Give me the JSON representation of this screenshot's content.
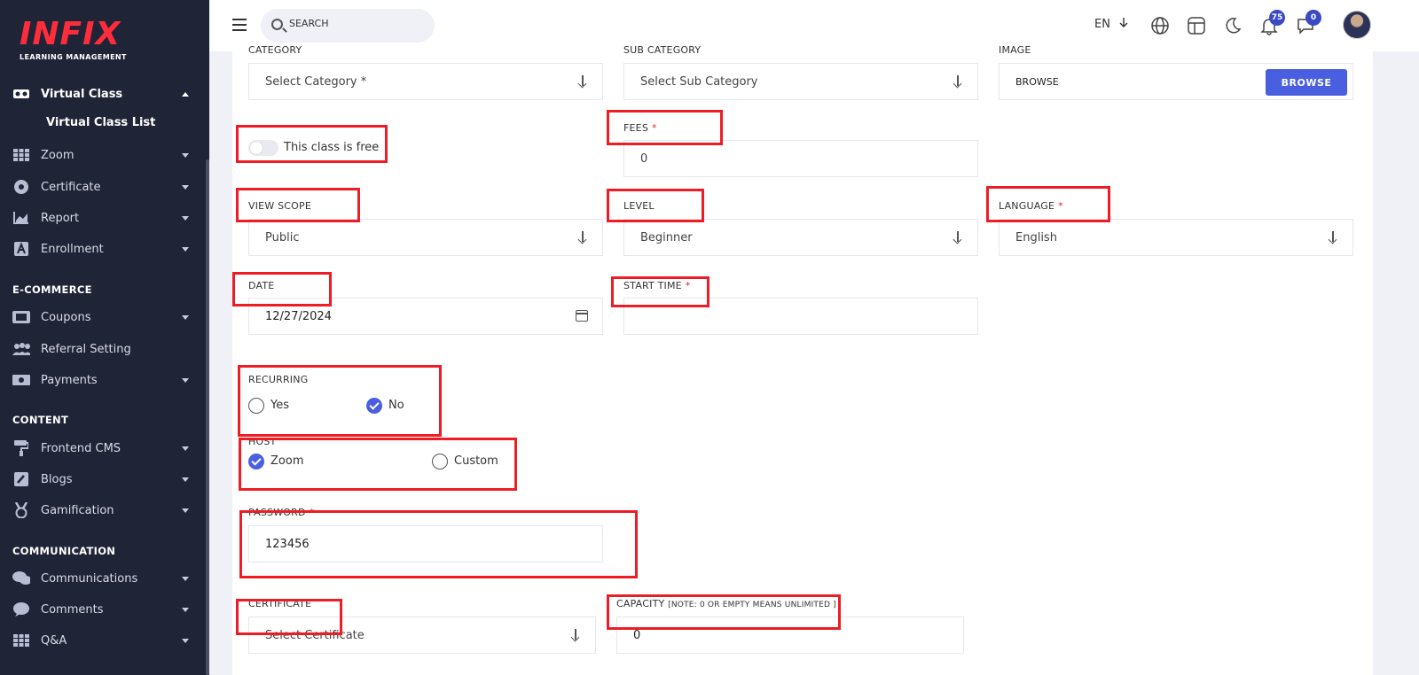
{
  "brand": {
    "logo_text": "INFIX",
    "logo_subtitle": "LEARNING MANAGEMENT"
  },
  "sidebar": {
    "active_group": {
      "label": "Virtual Class",
      "icon": "vr-headset-icon"
    },
    "active_sub": "Virtual Class List",
    "items": [
      {
        "label": "Zoom",
        "icon": "grid-icon"
      },
      {
        "label": "Certificate",
        "icon": "gear-badge-icon"
      },
      {
        "label": "Report",
        "icon": "chart-icon"
      },
      {
        "label": "Enrollment",
        "icon": "enroll-icon"
      }
    ],
    "sections": [
      {
        "title": "E-COMMERCE",
        "items": [
          {
            "label": "Coupons",
            "icon": "ticket-icon"
          },
          {
            "label": "Referral Setting",
            "icon": "users-icon"
          },
          {
            "label": "Payments",
            "icon": "money-icon"
          }
        ]
      },
      {
        "title": "CONTENT",
        "items": [
          {
            "label": "Frontend CMS",
            "icon": "paint-roller-icon"
          },
          {
            "label": "Blogs",
            "icon": "edit-icon"
          },
          {
            "label": "Gamification",
            "icon": "medal-icon"
          }
        ]
      },
      {
        "title": "COMMUNICATION",
        "items": [
          {
            "label": "Communications",
            "icon": "chat-icon"
          },
          {
            "label": "Comments",
            "icon": "comment-icon"
          },
          {
            "label": "Q&A",
            "icon": "grid-icon"
          }
        ]
      }
    ]
  },
  "topbar": {
    "search_placeholder": "SEARCH",
    "language": "EN",
    "notifications_count": "75",
    "messages_count": "0"
  },
  "form": {
    "category": {
      "label": "CATEGORY",
      "value": "Select Category *"
    },
    "sub_category": {
      "label": "SUB CATEGORY",
      "value": "Select Sub Category"
    },
    "image": {
      "label": "IMAGE",
      "value": "BROWSE",
      "button": "BROWSE"
    },
    "free_toggle": {
      "label": "This class is free",
      "checked": false
    },
    "fees": {
      "label": "FEES",
      "value": "0"
    },
    "view_scope": {
      "label": "VIEW SCOPE",
      "value": "Public"
    },
    "level": {
      "label": "LEVEL",
      "value": "Beginner"
    },
    "language": {
      "label": "LANGUAGE",
      "value": "English"
    },
    "date": {
      "label": "DATE",
      "value": "12/27/2024"
    },
    "start_time": {
      "label": "START TIME",
      "value": ""
    },
    "recurring": {
      "label": "RECURRING",
      "options": [
        "Yes",
        "No"
      ],
      "selected": "No"
    },
    "host": {
      "label": "HOST",
      "options": [
        "Zoom",
        "Custom"
      ],
      "selected": "Zoom"
    },
    "password": {
      "label": "PASSWORD",
      "value": "123456"
    },
    "certificate": {
      "label": "CERTIFICATE",
      "value": "Select Certificate"
    },
    "capacity": {
      "label": "CAPACITY",
      "note": "[NOTE: 0 OR EMPTY MEANS UNLIMITED ]",
      "value": "0"
    },
    "required_mark": "*"
  },
  "colors": {
    "sidebar_bg": "#202437",
    "accent": "#4a5fe0",
    "highlight": "#ee1c24",
    "logo": "#ff2d3b"
  }
}
